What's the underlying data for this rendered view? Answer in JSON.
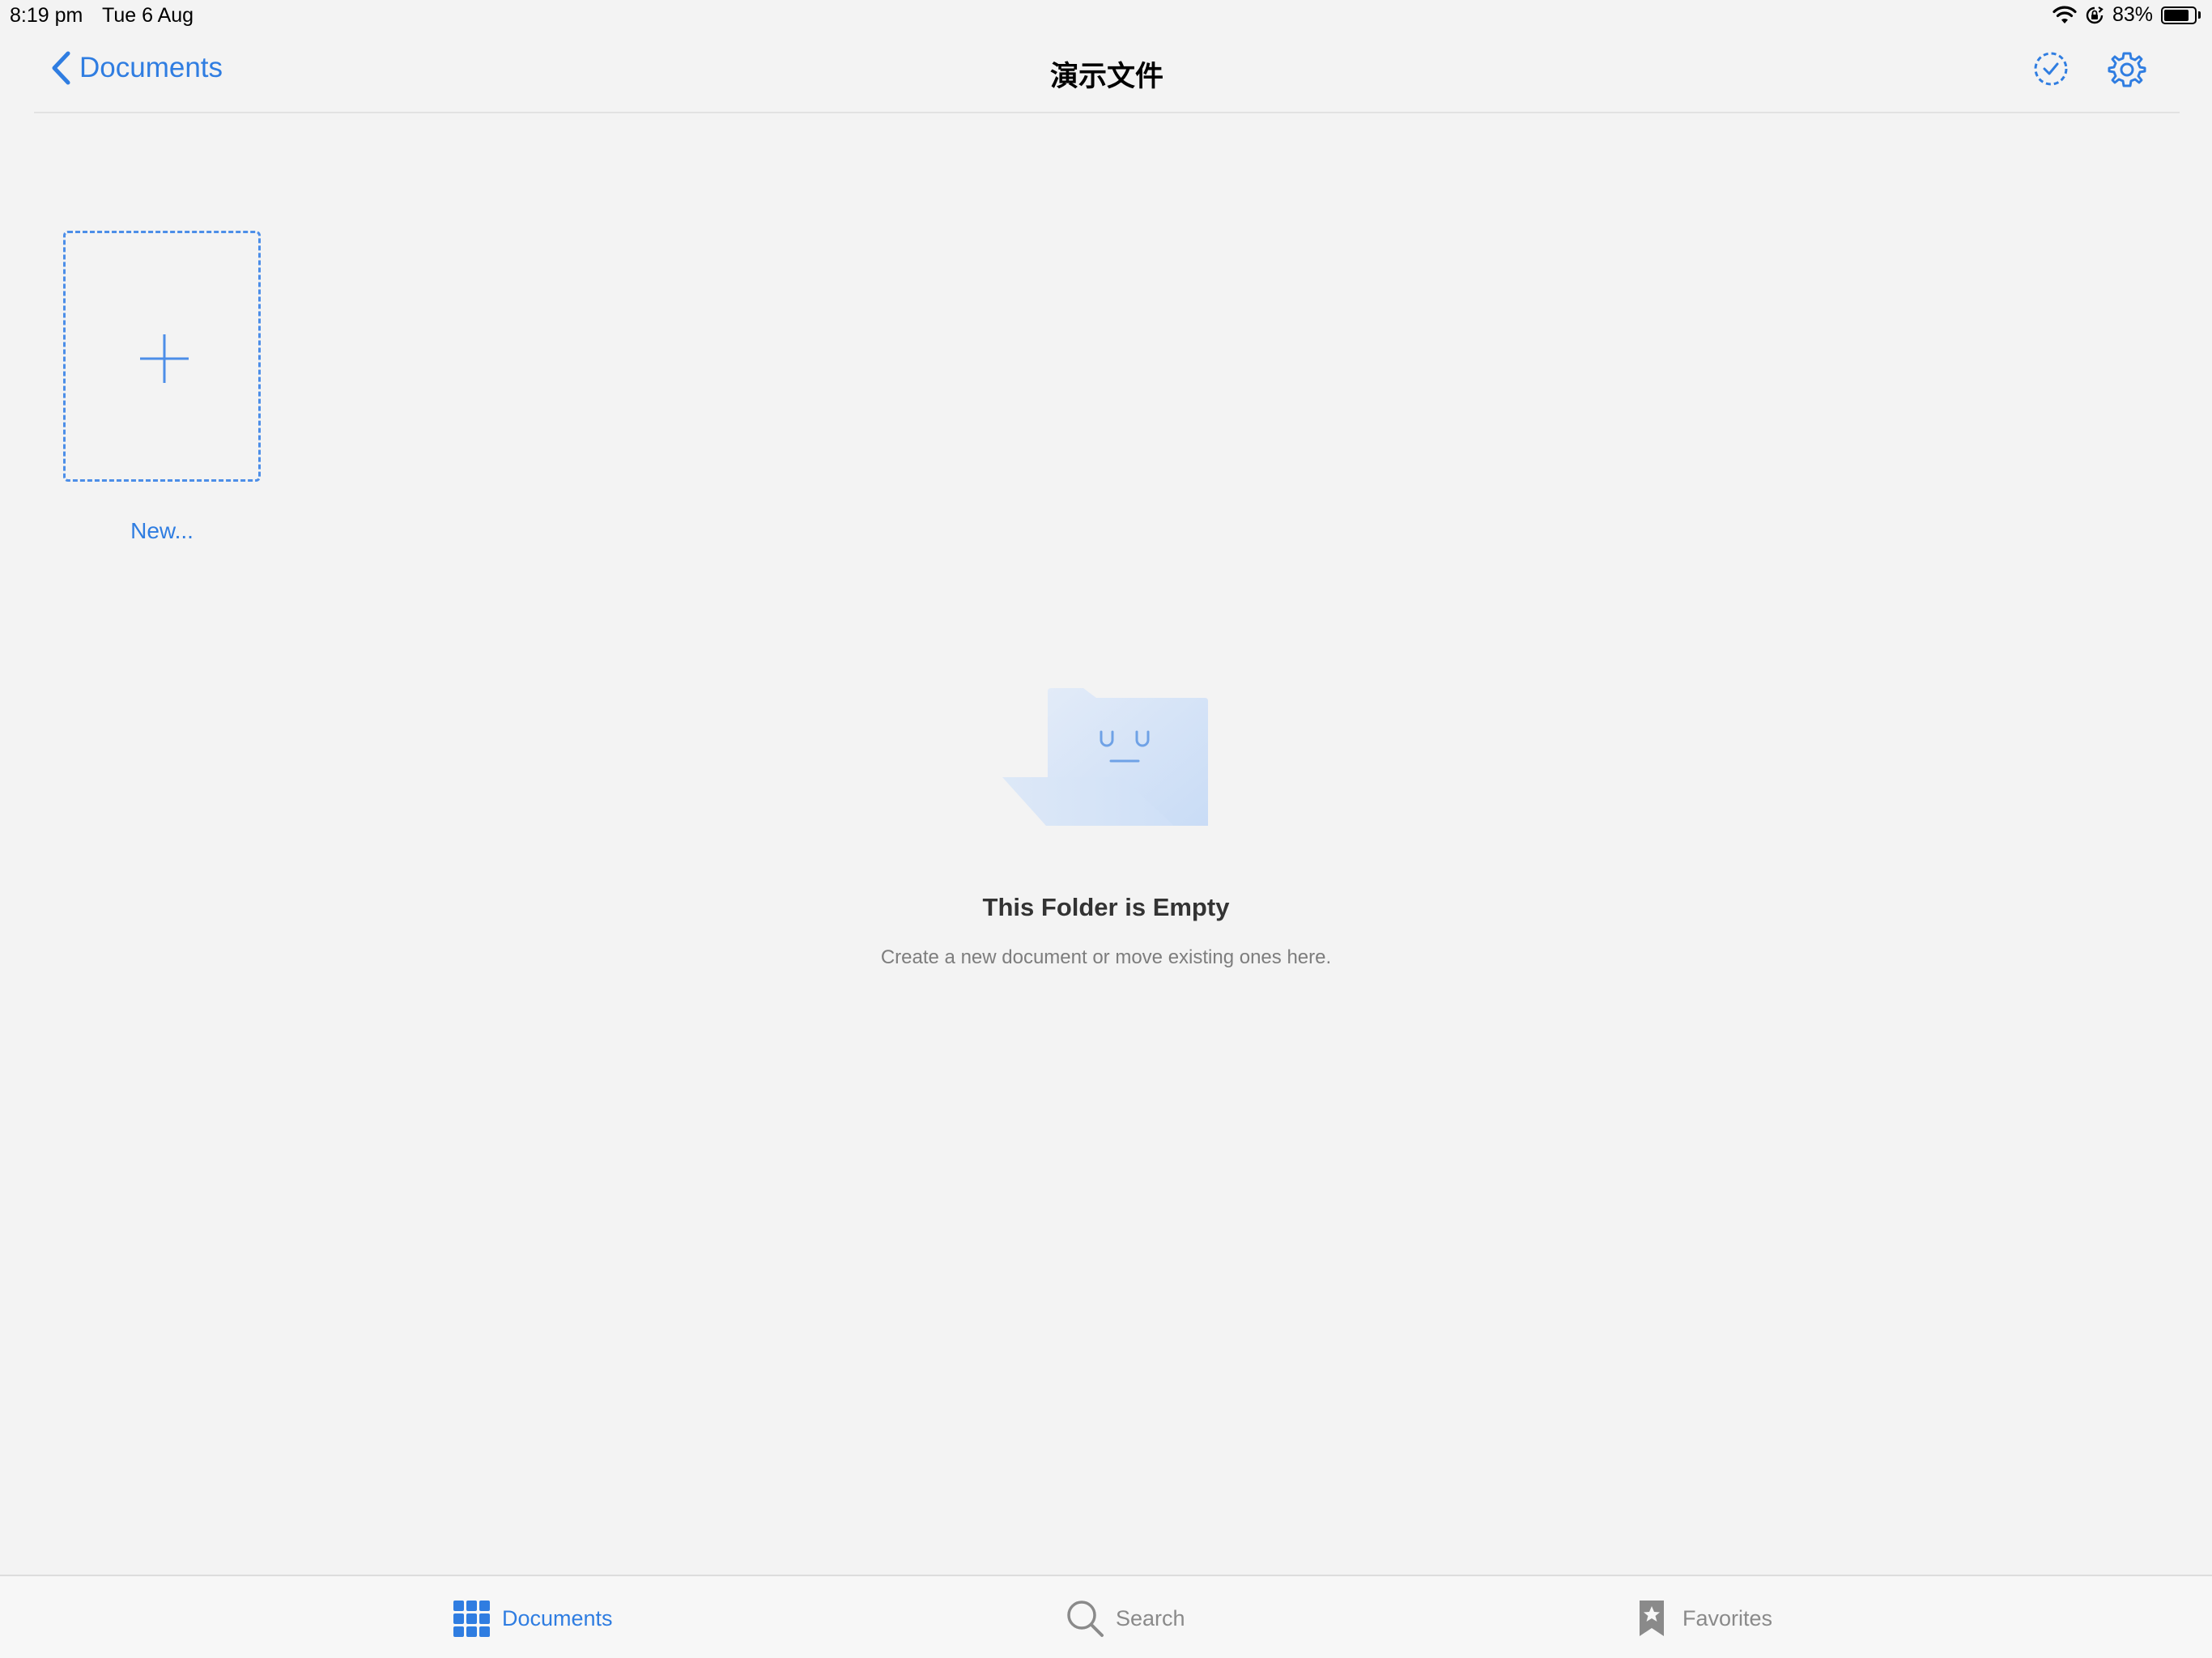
{
  "status_bar": {
    "time": "8:19 pm",
    "date": "Tue 6 Aug",
    "battery_percent_label": "83%",
    "battery_level": 0.83
  },
  "nav": {
    "back_label": "Documents",
    "title": "演示文件"
  },
  "grid": {
    "new_label": "New..."
  },
  "empty_state": {
    "title": "This Folder is Empty",
    "subtitle": "Create a new document or move existing ones here."
  },
  "tabs": [
    {
      "label": "Documents",
      "icon": "grid-icon",
      "selected": true
    },
    {
      "label": "Search",
      "icon": "search-icon",
      "selected": false
    },
    {
      "label": "Favorites",
      "icon": "bookmark-star-icon",
      "selected": false
    }
  ],
  "colors": {
    "accent": "#2f7de1",
    "background": "#f3f3f3",
    "tab_inactive": "#8a8a8a"
  }
}
